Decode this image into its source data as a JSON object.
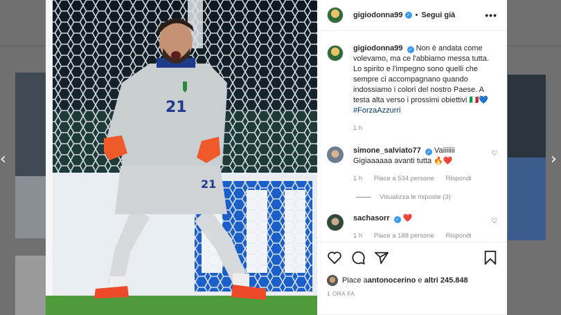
{
  "post": {
    "author": "gigiodonna99",
    "follow_status": "Segui già",
    "separator": "•",
    "more": "•••",
    "caption_text": "Non è andata come volevamo, ma ce l'abbiamo messa tutta. Lo spirito e l'impegno sono quelli che sempre ci accompagnano quando indossiamo i colori del nostro Paese. A testa alta verso i prossimi obiettivi 🇮🇹💙",
    "caption_hashtag": "#ForzaAzzurri",
    "caption_time": "1 h",
    "jersey_number": "21"
  },
  "comments": [
    {
      "username": "simone_salviato77",
      "text": "Vaiiiiiii Gigiaaaaaa avanti tutta 🔥❤️",
      "time": "1 h",
      "likes": "Piace a 534 persone",
      "reply": "Rispondi",
      "view_replies": "Visualizza le risposte (3)"
    },
    {
      "username": "sachasorr",
      "text": "❤️",
      "time": "1 h",
      "likes": "Piace a 188 persone",
      "reply": "Rispondi"
    }
  ],
  "actions": {
    "liked_by_prefix": "Piace a ",
    "liked_by_user": "antonocerino",
    "liked_by_mid": " e ",
    "liked_by_others": "altri 245.848",
    "timestamp": "1 ORA FA"
  },
  "icons": {
    "verified": "check-badge",
    "like": "heart-outline",
    "comment": "speech-bubble",
    "share": "paper-plane",
    "save": "bookmark",
    "comment_like": "heart-outline-small",
    "next": "chevron-right",
    "prev": "chevron-left"
  },
  "colors": {
    "verified": "#3897f0",
    "link": "#00376b",
    "muted": "#8e8e8e"
  }
}
